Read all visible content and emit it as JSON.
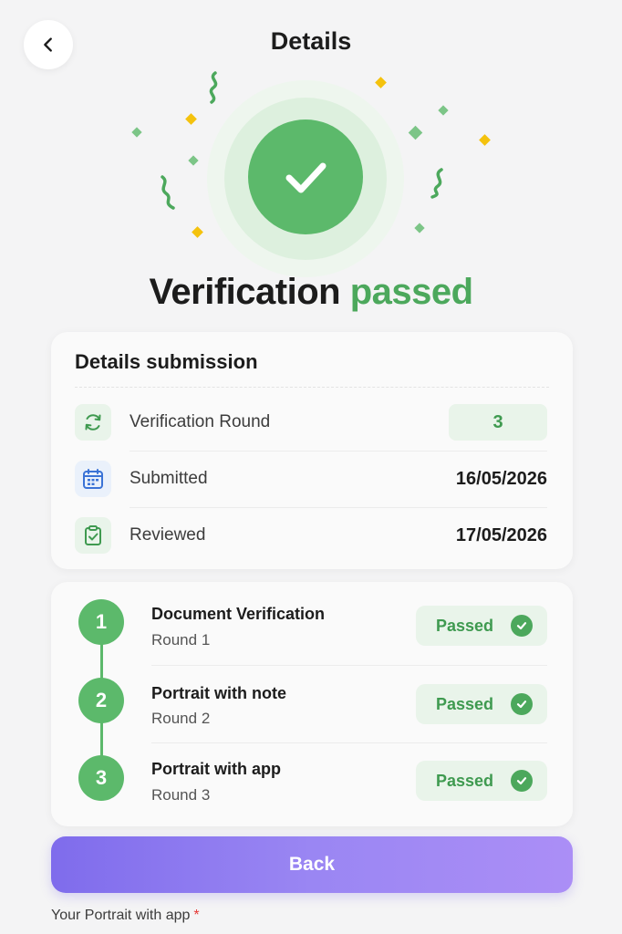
{
  "header": {
    "title": "Details",
    "back_icon": "chevron-left-icon"
  },
  "hero": {
    "status_icon": "check-icon",
    "headline_main": "Verification",
    "headline_accent": "passed",
    "accent_color": "#4ca85c",
    "confetti_colors": [
      "#5cb96b",
      "#f4c20d"
    ]
  },
  "details_card": {
    "title": "Details submission",
    "rows": [
      {
        "icon": "refresh-icon",
        "label": "Verification Round",
        "value": "3"
      },
      {
        "icon": "calendar-icon",
        "label": "Submitted",
        "value": "16/05/2026"
      },
      {
        "icon": "clipboard-check-icon",
        "label": "Reviewed",
        "value": "17/05/2026"
      }
    ]
  },
  "steps": [
    {
      "number": "1",
      "title": "Document Verification",
      "subtitle": "Round 1",
      "status": "Passed"
    },
    {
      "number": "2",
      "title": "Portrait with note",
      "subtitle": "Round 2",
      "status": "Passed"
    },
    {
      "number": "3",
      "title": "Portrait with app",
      "subtitle": "Round 3",
      "status": "Passed"
    }
  ],
  "actions": {
    "back_label": "Back",
    "button_gradient": [
      "#7f6cec",
      "#ab8ef6"
    ]
  },
  "footer": {
    "field_label": "Your Portrait with app",
    "required_mark": "*"
  }
}
